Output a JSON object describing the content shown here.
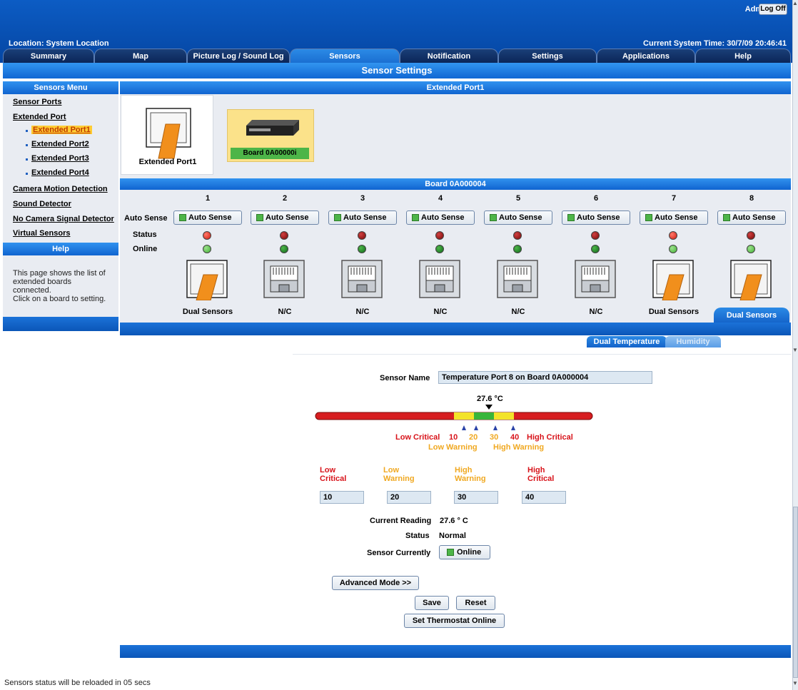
{
  "header": {
    "admin": "Admin",
    "logoff": "Log Off",
    "location": "Location: System Location",
    "system_time": "Current System Time: 30/7/09 20:46:41"
  },
  "tabs": [
    "Summary",
    "Map",
    "Picture Log / Sound Log",
    "Sensors",
    "Notification",
    "Settings",
    "Applications",
    "Help"
  ],
  "active_tab": "Sensors",
  "page_title": "Sensor Settings",
  "sidebar": {
    "title": "Sensors Menu",
    "items": [
      {
        "label": "Sensor Ports"
      },
      {
        "label": "Extended Port"
      },
      {
        "label": "Extended Port1"
      },
      {
        "label": "Extended Port2"
      },
      {
        "label": "Extended Port3"
      },
      {
        "label": "Extended Port4"
      },
      {
        "label": "Camera Motion Detection"
      },
      {
        "label": "Sound Detector"
      },
      {
        "label": "No Camera Signal Detector"
      },
      {
        "label": "Virtual Sensors"
      }
    ],
    "help_title": "Help",
    "help_lines": [
      "This page shows the list of",
      "extended boards",
      "connected.",
      "Click on a board to setting."
    ]
  },
  "extended": {
    "header": "Extended Port1",
    "port_label": "Extended Port1",
    "board_label": "Board 0A00000i"
  },
  "board": {
    "header": "Board 0A000004",
    "auto_sense_row": "Auto Sense",
    "status_row": "Status",
    "online_row": "Online",
    "ports": [
      {
        "num": "1",
        "button": "Auto Sense",
        "label": "Dual Sensors",
        "type": "dual",
        "status": "bright-red",
        "online": "bright-green"
      },
      {
        "num": "2",
        "button": "Auto Sense",
        "label": "N/C",
        "type": "nc",
        "status": "dark-red",
        "online": "dark-green"
      },
      {
        "num": "3",
        "button": "Auto Sense",
        "label": "N/C",
        "type": "nc",
        "status": "dark-red",
        "online": "dark-green"
      },
      {
        "num": "4",
        "button": "Auto Sense",
        "label": "N/C",
        "type": "nc",
        "status": "dark-red",
        "online": "dark-green"
      },
      {
        "num": "5",
        "button": "Auto Sense",
        "label": "N/C",
        "type": "nc",
        "status": "dark-red",
        "online": "dark-green"
      },
      {
        "num": "6",
        "button": "Auto Sense",
        "label": "N/C",
        "type": "nc",
        "status": "dark-red",
        "online": "dark-green"
      },
      {
        "num": "7",
        "button": "Auto Sense",
        "label": "Dual Sensors",
        "type": "dual",
        "status": "bright-red",
        "online": "bright-green"
      },
      {
        "num": "8",
        "button": "Auto Sense",
        "label": "Dual Sensors",
        "type": "dual",
        "status": "dark-red",
        "online": "bright-green"
      }
    ],
    "selected_tab": "Dual Sensors"
  },
  "sensor_tabs": [
    "Dual Temperature",
    "Humidity"
  ],
  "sensor": {
    "name_label": "Sensor Name",
    "name_value": "Temperature Port 8 on Board 0A000004",
    "gauge_reading": "27.6 °C",
    "thresholds": [
      "10",
      "20",
      "30",
      "40"
    ],
    "low_critical": "Low Critical",
    "low_warning": "Low Warning",
    "high_warning": "High Warning",
    "high_critical": "High Critical",
    "field_labels": [
      {
        "line1": "Low",
        "line2": "Critical"
      },
      {
        "line1": "Low",
        "line2": "Warning"
      },
      {
        "line1": "High",
        "line2": "Warning"
      },
      {
        "line1": "High",
        "line2": "Critical"
      }
    ],
    "field_values": [
      "10",
      "20",
      "30",
      "40"
    ],
    "current_reading_label": "Current Reading",
    "current_reading_value": "27.6 ° C",
    "status_label": "Status",
    "status_value": "Normal",
    "sensor_currently_label": "Sensor Currently",
    "sensor_currently_value": "Online",
    "advanced": "Advanced Mode >>",
    "save": "Save",
    "reset": "Reset",
    "set_thermostat": "Set Thermostat Online"
  },
  "footer": "Sensors status will be reloaded in 05 secs",
  "colors": {
    "accent": "#1067d3",
    "critical": "#d8131a",
    "warning": "#f0a820",
    "online": "#4db548"
  }
}
